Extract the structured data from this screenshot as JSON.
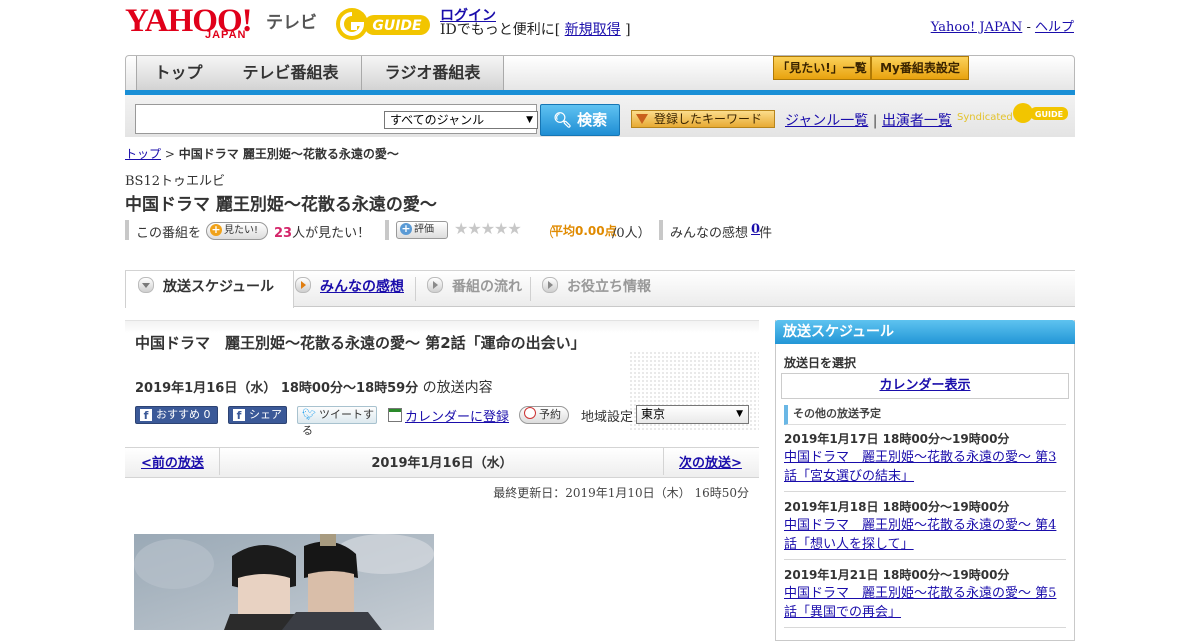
{
  "header": {
    "logo_yahoo": "YAHOO!",
    "logo_japan": "JAPAN",
    "logo_tv": "テレビ",
    "logo_gguide": "G GUIDE",
    "login_label": "ログイン",
    "login_sub_prefix": "IDでもっと便利に[",
    "signup_label": "新規取得",
    "login_sub_suffix": "]",
    "yahoo_japan_link": "Yahoo! JAPAN",
    "separator": " - ",
    "help_link": "ヘルプ"
  },
  "nav": {
    "tabs": [
      {
        "label": "トップ"
      },
      {
        "label": "テレビ番組表"
      },
      {
        "label": "ラジオ番組表"
      }
    ],
    "want_to_see_list": "「見たい!」一覧",
    "my_schedule": "My番組表設定"
  },
  "search": {
    "input_value": "",
    "genre_selected": "すべてのジャンル",
    "search_button": "検索",
    "keyword_button": "登録したキーワード",
    "genre_list_link": "ジャンル一覧",
    "link_separator": "|",
    "performer_list_link": "出演者一覧",
    "syndicated": "Syndicated"
  },
  "breadcrumb": {
    "top": "トップ",
    "sep": " > ",
    "current": "中国ドラマ 麗王別姫～花散る永遠の愛～"
  },
  "program": {
    "channel": "BS12トゥエルビ",
    "title": "中国ドラマ 麗王別姫～花散る永遠の愛～",
    "this_program": "この番組を",
    "want_button": "見たい!",
    "want_count": "23",
    "want_suffix": "人が見たい！",
    "rate_button": "評価",
    "stars": "★★★★★",
    "rating_open": "（",
    "rating_label": "平均0.00点",
    "rating_count": "/0人）",
    "reviews_label": "みんなの感想",
    "reviews_count": "0",
    "reviews_suffix": "件"
  },
  "section_tabs": {
    "schedule": "放送スケジュール",
    "reviews": "みんなの感想",
    "flow": "番組の流れ",
    "info": "お役立ち情報"
  },
  "episode": {
    "title": "中国ドラマ　麗王別姫～花散る永遠の愛～ 第2話「運命の出会い」",
    "datetime": "2019年1月16日（水） 18時00分～18時59分",
    "datetime_suffix": " の放送内容",
    "fb_recommend": "おすすめ 0",
    "fb_share": "シェア",
    "tweet": "ツイートする",
    "calendar_register": "カレンダーに登録",
    "reserve": "予約",
    "region_label": "地域設定",
    "region_selected": "東京"
  },
  "date_nav": {
    "prev": "<前の放送",
    "current": "2019年1月16日（水）",
    "next": "次の放送>",
    "last_updated": "最終更新日：2019年1月10日（木） 16時50分"
  },
  "sidebar": {
    "header": "放送スケジュール",
    "select_day": "放送日を選択",
    "calendar_link": "カレンダー表示",
    "other_label": "その他の放送予定",
    "items": [
      {
        "when": "2019年1月17日 18時00分～19時00分",
        "what": "中国ドラマ　麗王別姫～花散る永遠の愛～ 第3話「宮女選びの結末」"
      },
      {
        "when": "2019年1月18日 18時00分～19時00分",
        "what": "中国ドラマ　麗王別姫～花散る永遠の愛～ 第4話「想い人を探して」"
      },
      {
        "when": "2019年1月21日 18時00分～19時00分",
        "what": "中国ドラマ　麗王別姫～花散る永遠の愛～ 第5話「異国での再会」"
      }
    ]
  },
  "colors": {
    "link": "#1a0dab",
    "accent_blue": "#1a8fd6",
    "yahoo_red": "#e0001a",
    "gguide_yellow": "#f2c500",
    "want_count": "#d4266a",
    "rating_orange": "#e08a00"
  },
  "icons": {
    "search": "magnifier-icon",
    "plus": "plus-icon",
    "facebook": "facebook-icon",
    "twitter": "twitter-bird-icon",
    "calendar": "calendar-icon",
    "clock": "clock-icon"
  }
}
